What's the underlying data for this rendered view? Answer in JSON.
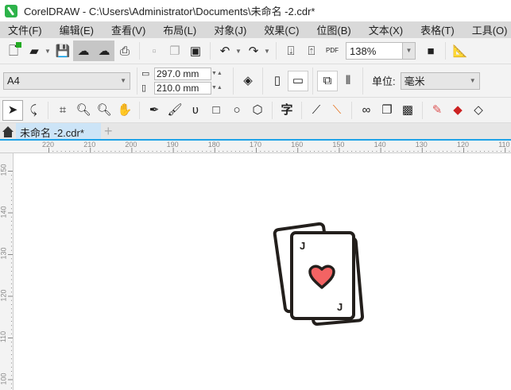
{
  "window": {
    "title": "CorelDRAW - C:\\Users\\Administrator\\Documents\\未命名 -2.cdr*"
  },
  "menu": [
    "文件(F)",
    "编辑(E)",
    "查看(V)",
    "布局(L)",
    "对象(J)",
    "效果(C)",
    "位图(B)",
    "文本(X)",
    "表格(T)",
    "工具(O)"
  ],
  "toolbar": {
    "zoom_value": "138%",
    "pdf_label": "PDF"
  },
  "property_bar": {
    "page_size": "A4",
    "width": "297.0 mm",
    "height": "210.0 mm",
    "units_label": "单位:",
    "units_value": "毫米"
  },
  "toolbox": {
    "text_tool_glyph": "字"
  },
  "document_tab": {
    "label": "未命名 -2.cdr*",
    "add_label": "+"
  },
  "rulers": {
    "horizontal": [
      "220",
      "210",
      "200",
      "190",
      "180",
      "170",
      "160",
      "150",
      "140",
      "130",
      "120",
      "110"
    ],
    "vertical": [
      "150",
      "140",
      "130",
      "120",
      "110",
      "100"
    ]
  },
  "artwork": {
    "card_letter": "J",
    "heart_color": "#f36363",
    "outline_color": "#231f1c"
  }
}
